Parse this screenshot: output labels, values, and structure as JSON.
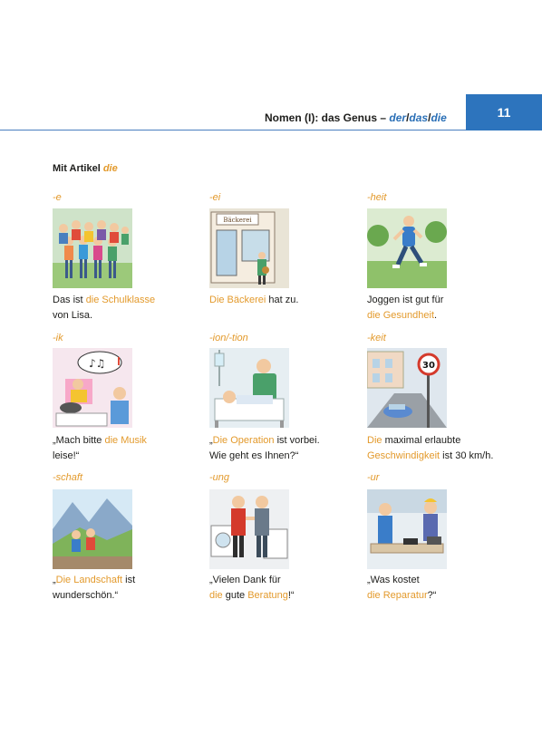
{
  "header": {
    "title_prefix": "Nomen (I): das Genus –",
    "article_der": "der",
    "slash1": "/",
    "article_das": "das",
    "slash2": "/",
    "article_die": "die",
    "page_number": "11"
  },
  "section": {
    "title_prefix": "Mit Artikel",
    "title_article": "die"
  },
  "items": [
    {
      "suffix": "-e",
      "line1": [
        "Das ist ",
        "die Schulklasse",
        ""
      ],
      "line2": [
        "von Lisa.",
        "",
        ""
      ]
    },
    {
      "suffix": "-ei",
      "line1": [
        "",
        "Die Bäckerei",
        " hat zu."
      ],
      "line2": [
        "",
        "",
        ""
      ]
    },
    {
      "suffix": "-heit",
      "line1": [
        "Joggen ist gut für",
        "",
        ""
      ],
      "line2": [
        "",
        "die Gesundheit",
        "."
      ]
    },
    {
      "suffix": "-ik",
      "line1": [
        "„Mach bitte ",
        "die Musik",
        ""
      ],
      "line2": [
        "leise!“",
        "",
        ""
      ]
    },
    {
      "suffix": "-ion/-tion",
      "line1": [
        "„",
        "Die Operation",
        " ist vorbei."
      ],
      "line2": [
        "Wie geht es Ihnen?“",
        "",
        ""
      ]
    },
    {
      "suffix": "-keit",
      "line1": [
        "",
        "Die",
        " maximal erlaubte"
      ],
      "line2": [
        "",
        "Geschwindigkeit",
        " ist 30 km/h."
      ]
    },
    {
      "suffix": "-schaft",
      "line1": [
        "„",
        "Die Landschaft",
        " ist"
      ],
      "line2": [
        "wunderschön.“",
        "",
        ""
      ]
    },
    {
      "suffix": "-ung",
      "line1": [
        "„Vielen Dank für",
        "",
        ""
      ],
      "line2": [
        "",
        "die",
        " gute "
      ],
      "line2b": [
        "Beratung",
        "!“"
      ]
    },
    {
      "suffix": "-ur",
      "line1": [
        "„Was kostet",
        "",
        ""
      ],
      "line2": [
        "",
        "die Reparatur",
        "?“"
      ]
    }
  ],
  "sign_text": "30",
  "shop_sign_text": "Bäckerei",
  "colors": {
    "accent": "#e39a2c",
    "blue": "#2d74bd"
  }
}
